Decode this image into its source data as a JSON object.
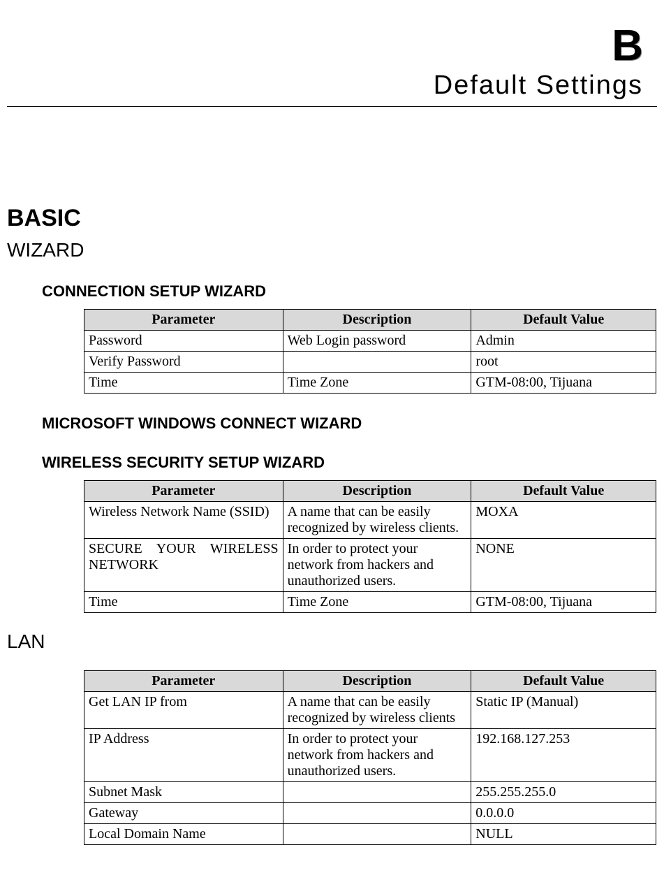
{
  "appendix": {
    "letter": "B",
    "title": "Default Settings"
  },
  "section_basic": "BASIC",
  "section_wizard": "WIZARD",
  "section_lan": "LAN",
  "headers": {
    "parameter": "Parameter",
    "description": "Description",
    "default_value": "Default Value"
  },
  "conn_wizard": {
    "title": "CONNECTION SETUP WIZARD",
    "rows": [
      {
        "param": "Password",
        "desc": "Web Login password",
        "val": "Admin"
      },
      {
        "param": "Verify Password",
        "desc": "",
        "val": "root"
      },
      {
        "param": "Time",
        "desc": "Time Zone",
        "val": "GTM-08:00, Tijuana"
      }
    ]
  },
  "ms_wizard": {
    "title": "MICROSOFT WINDOWS CONNECT WIZARD"
  },
  "wireless_wizard": {
    "title": "WIRELESS SECURITY SETUP WIZARD",
    "rows": [
      {
        "param": "Wireless Network Name (SSID)",
        "desc": "A name that can be easily recognized by wireless clients.",
        "val": "MOXA"
      },
      {
        "param": "SECURE YOUR WIRELESS NETWORK",
        "desc": "In order to protect your network from hackers and unauthorized users.",
        "val": "NONE"
      },
      {
        "param": "Time",
        "desc": "Time Zone",
        "val": "GTM-08:00, Tijuana"
      }
    ]
  },
  "lan": {
    "rows": [
      {
        "param": "Get LAN IP from",
        "desc": "A name that can be easily recognized by wireless clients",
        "val": "Static IP (Manual)"
      },
      {
        "param": "IP Address",
        "desc": "In order to protect your network from hackers and unauthorized users.",
        "val": "192.168.127.253"
      },
      {
        "param": "Subnet Mask",
        "desc": "",
        "val": "255.255.255.0"
      },
      {
        "param": "Gateway",
        "desc": "",
        "val": "0.0.0.0"
      },
      {
        "param": "Local Domain Name",
        "desc": "",
        "val": "NULL"
      }
    ]
  }
}
